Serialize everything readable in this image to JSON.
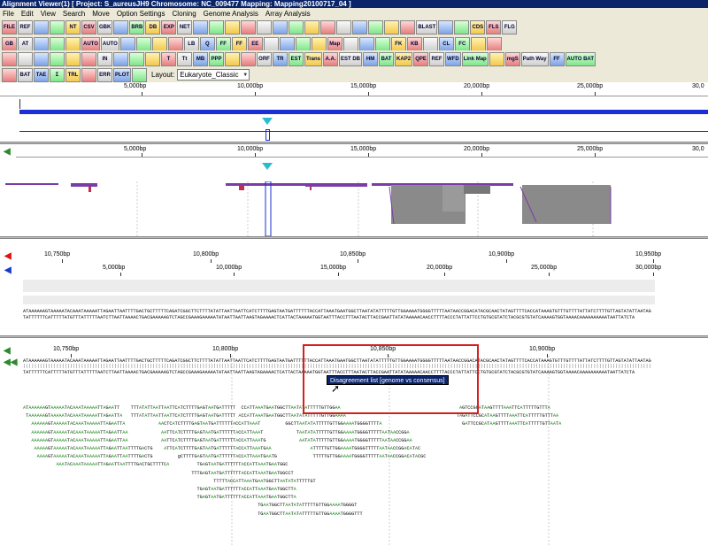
{
  "window": {
    "title": "Alignment Viewer(1) [ Project: S_aureusJH9 Chromosome: NC_009477 Mapping: Mapping20100717_04 ]"
  },
  "menu": [
    "File",
    "Edit",
    "View",
    "Search",
    "Move",
    "Option Settings",
    "Cloning",
    "Genome Analysis",
    "Array Analysis"
  ],
  "toolbar1": [
    "FILE",
    "REF",
    "",
    "",
    "NT",
    "CSV",
    "GBK",
    "",
    "BRB",
    "DB",
    "EXP",
    "NET",
    "",
    "",
    "",
    "",
    "",
    "",
    "",
    "",
    "",
    "",
    "",
    "",
    "",
    "",
    "BLAST",
    "",
    "",
    "CDS",
    "FLS",
    "FLG"
  ],
  "toolbar2": [
    "GB",
    "AT",
    "",
    "",
    "",
    "AUTO",
    "AUTO",
    "",
    "",
    "",
    "",
    "LB",
    "Q",
    "FF",
    "FF",
    "EE",
    "",
    "",
    "",
    "",
    "Map",
    "",
    "",
    "",
    "FK",
    "KB",
    "",
    "CL",
    "FC",
    "",
    ""
  ],
  "toolbar3": [
    "",
    "",
    "",
    "",
    "",
    "",
    "IN",
    "",
    "",
    "",
    "T",
    "Tt",
    "MB",
    "PPP",
    "",
    "",
    "ORF",
    "TR",
    "EST",
    "Trans",
    "A.A.",
    "EST DB",
    "HM",
    "BAT",
    "KAP2",
    "QPE",
    "REF",
    "WFD",
    "Link Map",
    "",
    "mgS",
    "Path Way",
    "FF",
    "AUTO BAT"
  ],
  "toolbar4": [
    "",
    "BAT",
    "TAE",
    "Σ",
    "TRL",
    "",
    "ERR",
    "PLOT",
    ""
  ],
  "layout": {
    "label": "Layout:",
    "value": "Eukaryote_Classic"
  },
  "ruler_top": [
    "5,000bp",
    "10,000bp",
    "15,000bp",
    "20,000bp",
    "25,000bp",
    "30,0"
  ],
  "ruler_mid": [
    "5,000bp",
    "10,000bp",
    "15,000bp",
    "20,000bp",
    "25,000bp",
    "30,0"
  ],
  "ruler_detail": [
    "10,750bp",
    "10,800bp",
    "10,850bp",
    "10,900bp",
    "10,950bp"
  ],
  "ruler_detail_sub": [
    "5,000bp",
    "10,000bp",
    "15,000bp",
    "20,000bp",
    "25,000bp",
    "30,000bp"
  ],
  "ruler_bottom": [
    "10,750bp",
    "10,800bp",
    "10,850bp",
    "10,900bp"
  ],
  "tooltip": "Disagreement list [genome vs consensus]",
  "consensus_top": "ATAAAAAAGTAAAAATACAAATAAAAATTAGAATTAATTTTGACTGCTTTTTCAGATCGGCTTCTTTTATATTAATTAATTCATCTTTTGAGTAATGATTTTTTACCATTAAATGAATGGCTTAATATATTTTTGTTGGAAAATGGGGTTTTTAATAACCGGACATACGCAACTATAGTTTTCACCATAAAGTGTTTGTTTTATTATCTTTTGTTAGTATATTAATAG",
  "consensus_bottom": "TATTTTTTCATTTTTATGTTTATTTTTAATCTTAATTAAAACTGACGAAAAAGTCTAGCCGAAAGAAAAATATAATTAATTAAGTAGAAAACTCATTACTAAAAATGGTAATTTACCTTTAATACTTACCGAATTATATAAAAACAACCTTTTACCCTATTATTCCTGTGCGTATCTACGCGTGTATCAAAAGTGGTAAAACAAAAAAAAAATAATTATCTA",
  "aligned_top": "ATAAAAAAGTAAAAATACAAATAAAAATTAGAATTAATTTTGACTGCTTTTTCAGATCGGCTTCTTTTATATTAATTAATTCATCTTTTGAGTAATGATTTTTTACCATTAAATGAATGGCTTAATATATTTTTGTTGGAAAATGGGGTTTTTAATAACCGGACATACGCAACTATAGTTTTCACCATAAAGTGTTTGTTTTATTATCTTTTGTTAGTATATTAATAG",
  "aligned_bottom": "TATTTTTTCATTTTTATGTTTATTTTTAATCTTAATTAAAACTGACGAAAAAGTCTAGCCGAAAGAAAAATATAATTAATTAAGTAGAAAACTCATTACTAAAAATGGTAATTTACCTTTAATACTTACCGAATTATATAAAAACAACCTTTTACCCTATTATTCCTGTGCGTATCTACGCGTGTATCAAAAGTGGTAAAACAAAAAAAAAATAATTATCTA",
  "reads": [
    {
      "text": "ATAAAAAAGTAAAAATACAAATAAAAATTAGAATT",
      "row": 0,
      "col": 0
    },
    {
      "text": "TTTATATTAATTAATTCATCTTTTGAGTAATGATTTTT",
      "row": 0,
      "col": 39
    },
    {
      "text": "CCATTAAATGAATGGCTTAATATATTTTTGTTGGAA",
      "row": 0,
      "col": 79
    },
    {
      "text": "AGTCCGCATAAGTTTTAAATTCATTTTTGTTTA",
      "row": 0,
      "col": 158
    },
    {
      "text": "TAAAAAAGTAAAAATACAAATAAAAATTAGAATTA",
      "row": 1,
      "col": 1
    },
    {
      "text": "TTTATATTAATTAATTCATCTTTTGAGTAATGATTTTT",
      "row": 1,
      "col": 39
    },
    {
      "text": "ACCATTAAATGAATGGCTTAATATATTTTTGTTGGAAAA",
      "row": 1,
      "col": 78
    },
    {
      "text": "TAGATTCCGCATAAGTTTTAAATTCATTTTTGTTTAA",
      "row": 1,
      "col": 157
    },
    {
      "text": "AAAAAAGTAAAAATACAAATAAAAATTAGAATTA",
      "row": 2,
      "col": 3
    },
    {
      "text": "AACTCATCTTTTGAGTAATGATTTTTTACCATTAAAT",
      "row": 2,
      "col": 49
    },
    {
      "text": "GGCTTAATATATTTTTGTTGGAAAATGGGGTTTTA",
      "row": 2,
      "col": 95
    },
    {
      "text": "GATTCCGCATAAGTTTTAAATTCATTTTTGTTAATA",
      "row": 2,
      "col": 159
    },
    {
      "text": "AAAAAAGTAAAAATACAAATAAAAATTAGAATTAA",
      "row": 3,
      "col": 3
    },
    {
      "text": "AATTCATCTTTTGAGTAATGATTTTTTACCATTAAAT",
      "row": 3,
      "col": 50
    },
    {
      "text": "TAATATATTTTTGTTGGAAAATGGGGTTTTTAATAACCGGA",
      "row": 3,
      "col": 99
    },
    {
      "text": "AAAAAAGTAAAAATACAAATAAAAATTAGAATTAA",
      "row": 4,
      "col": 3
    },
    {
      "text": "AATTCATCTTTTGAGTAATGATTTTTTACCATTAAATG",
      "row": 4,
      "col": 50
    },
    {
      "text": "AATATATTTTTGTTGGAAAATGGGGTTTTTAATAACCGGAA",
      "row": 4,
      "col": 100
    },
    {
      "text": "AAAAAGTAAAAATACAAATAAAAATTAGAATTAATTTTGACTG",
      "row": 5,
      "col": 4
    },
    {
      "text": "ATTCATCTTTTGAGTAATGATTTTTTACCATTAAATGAA",
      "row": 5,
      "col": 51
    },
    {
      "text": "ATTTTTGTTGGAAAATGGGGTTTTTAATAACCGGACATAC",
      "row": 5,
      "col": 104
    },
    {
      "text": "AAAAGTAAAAATACAAATAAAAATTAGAATTAATTTTGACTG",
      "row": 6,
      "col": 5
    },
    {
      "text": "gCTTTTGAGTAATGATTTTTTACCATTAAATGAATG",
      "row": 6,
      "col": 56
    },
    {
      "text": "TTTTTGTTGGAAAATGGGGTTTTTAATAACCGGACATACGC",
      "row": 6,
      "col": 105
    },
    {
      "text": "AAATACAAATAAAAATTAGAATTAATTTTGACTGCTTTTCA",
      "row": 7,
      "col": 12
    },
    {
      "text": "TGAGTAATGATTTTTTACCATTAAATGAATGGC",
      "row": 7,
      "col": 63
    },
    {
      "text": "TTTGAGTAATGATTTTTTACCATTAAATGAATGGCCT",
      "row": 8,
      "col": 61
    },
    {
      "text": "TTTTTACCATTAAATGAATGGCTTAATATATTTTTGT",
      "row": 9,
      "col": 69
    },
    {
      "text": "TGAGTAATGATTTTTTACCATTAAATGAATGGCTTA",
      "row": 10,
      "col": 63
    },
    {
      "text": "TGAGTAATGATTTTTTACCATTAAATGAATGGCTTA",
      "row": 11,
      "col": 63
    },
    {
      "text": "TGAATGGCTTAATATATTTTTGTTGGAAAATGGGGT",
      "row": 12,
      "col": 85
    },
    {
      "text": "TGAATGGCTTAATATATTTTTGTTGGAAAATGGGGTTT",
      "row": 13,
      "col": 85
    }
  ]
}
